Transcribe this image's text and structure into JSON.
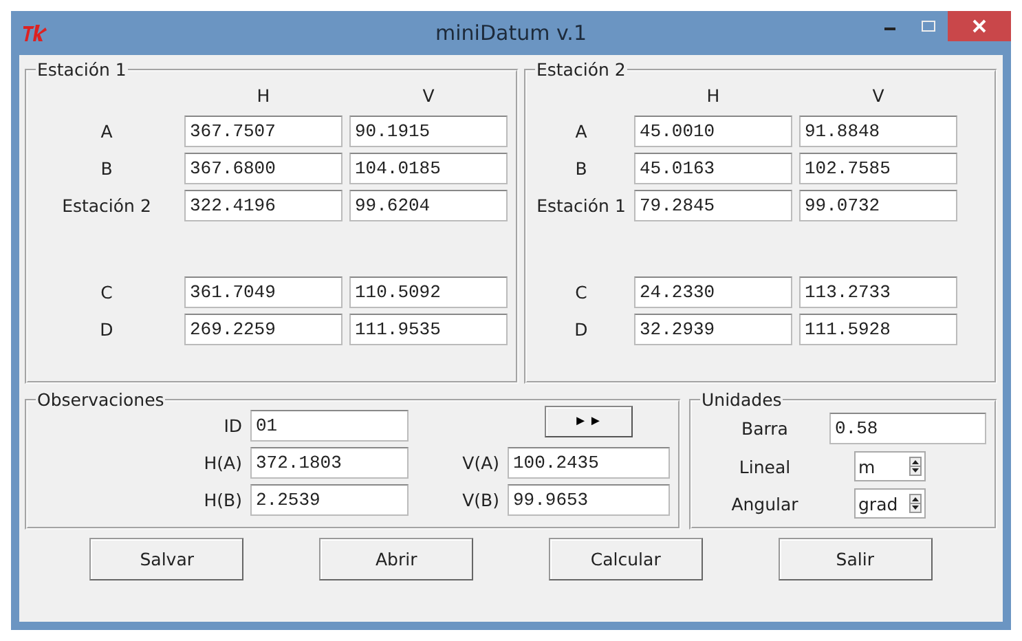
{
  "window": {
    "title": "miniDatum v.1"
  },
  "stations": [
    {
      "title": "Estación 1",
      "columns": [
        "H",
        "V"
      ],
      "groups": [
        [
          {
            "label": "A",
            "h": "367.7507",
            "v": "90.1915"
          },
          {
            "label": "B",
            "h": "367.6800",
            "v": "104.0185"
          },
          {
            "label": "Estación 2",
            "h": "322.4196",
            "v": "99.6204"
          }
        ],
        [
          {
            "label": "C",
            "h": "361.7049",
            "v": "110.5092"
          },
          {
            "label": "D",
            "h": "269.2259",
            "v": "111.9535"
          }
        ]
      ]
    },
    {
      "title": "Estación 2",
      "columns": [
        "H",
        "V"
      ],
      "groups": [
        [
          {
            "label": "A",
            "h": "45.0010",
            "v": "91.8848"
          },
          {
            "label": "B",
            "h": "45.0163",
            "v": "102.7585"
          },
          {
            "label": "Estación 1",
            "h": "79.2845",
            "v": "99.0732"
          }
        ],
        [
          {
            "label": "C",
            "h": "24.2330",
            "v": "113.2733"
          },
          {
            "label": "D",
            "h": "32.2939",
            "v": "111.5928"
          }
        ]
      ]
    }
  ],
  "observaciones": {
    "title": "Observaciones",
    "id": {
      "label": "ID",
      "value": "01"
    },
    "next_button": "►►",
    "fields": [
      {
        "label": "H(A)",
        "value": "372.1803"
      },
      {
        "label": "V(A)",
        "value": "100.2435"
      },
      {
        "label": "H(B)",
        "value": "2.2539"
      },
      {
        "label": "V(B)",
        "value": "99.9653"
      }
    ]
  },
  "unidades": {
    "title": "Unidades",
    "barra": {
      "label": "Barra",
      "value": "0.58"
    },
    "spinners": [
      {
        "label": "Lineal",
        "value": "m"
      },
      {
        "label": "Angular",
        "value": "grad"
      }
    ]
  },
  "buttons": [
    "Salvar",
    "Abrir",
    "Calcular",
    "Salir"
  ]
}
